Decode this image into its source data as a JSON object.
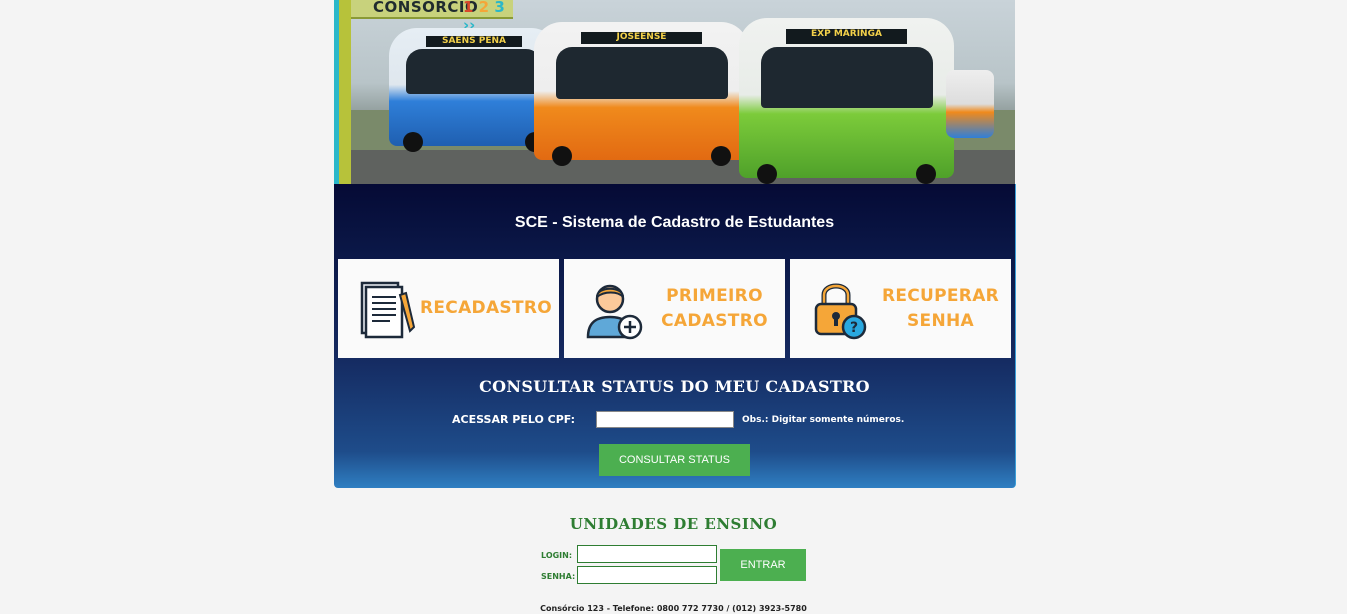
{
  "banner": {
    "logo_text": "CONSÓRCIO",
    "logo_nums": "1 2 3 › ›",
    "bus_signs": [
      "SAENS PENA",
      "JOSEENSE",
      "EXP MARINGA"
    ]
  },
  "panel": {
    "title": "SCE - Sistema de Cadastro de Estudantes",
    "tiles": [
      {
        "label": "RECADASTRO",
        "icon": "document-pen-icon"
      },
      {
        "label": "PRIMEIRO CADASTRO",
        "line1": "PRIMEIRO",
        "line2": "CADASTRO",
        "icon": "user-add-icon"
      },
      {
        "label": "RECUPERAR SENHA",
        "line1": "RECUPERAR",
        "line2": "SENHA",
        "icon": "padlock-question-icon"
      }
    ],
    "status_title": "CONSULTAR STATUS DO MEU CADASTRO",
    "cpf_label": "ACESSAR PELO CPF:",
    "cpf_value": "",
    "cpf_note": "Obs.: Digitar somente números.",
    "status_button": "CONSULTAR STATUS"
  },
  "units": {
    "title": "UNIDADES DE ENSINO",
    "login_label": "LOGIN:",
    "senha_label": "SENHA:",
    "login_value": "",
    "senha_value": "",
    "enter_button": "ENTRAR"
  },
  "footer": "Consórcio 123 - Telefone: 0800 772 7730 / (012) 3923-5780",
  "colors": {
    "accent_green": "#4caf50",
    "tile_text_orange": "#f5a638",
    "units_green": "#2e7d32",
    "panel_dark_blue": "#050a35"
  }
}
